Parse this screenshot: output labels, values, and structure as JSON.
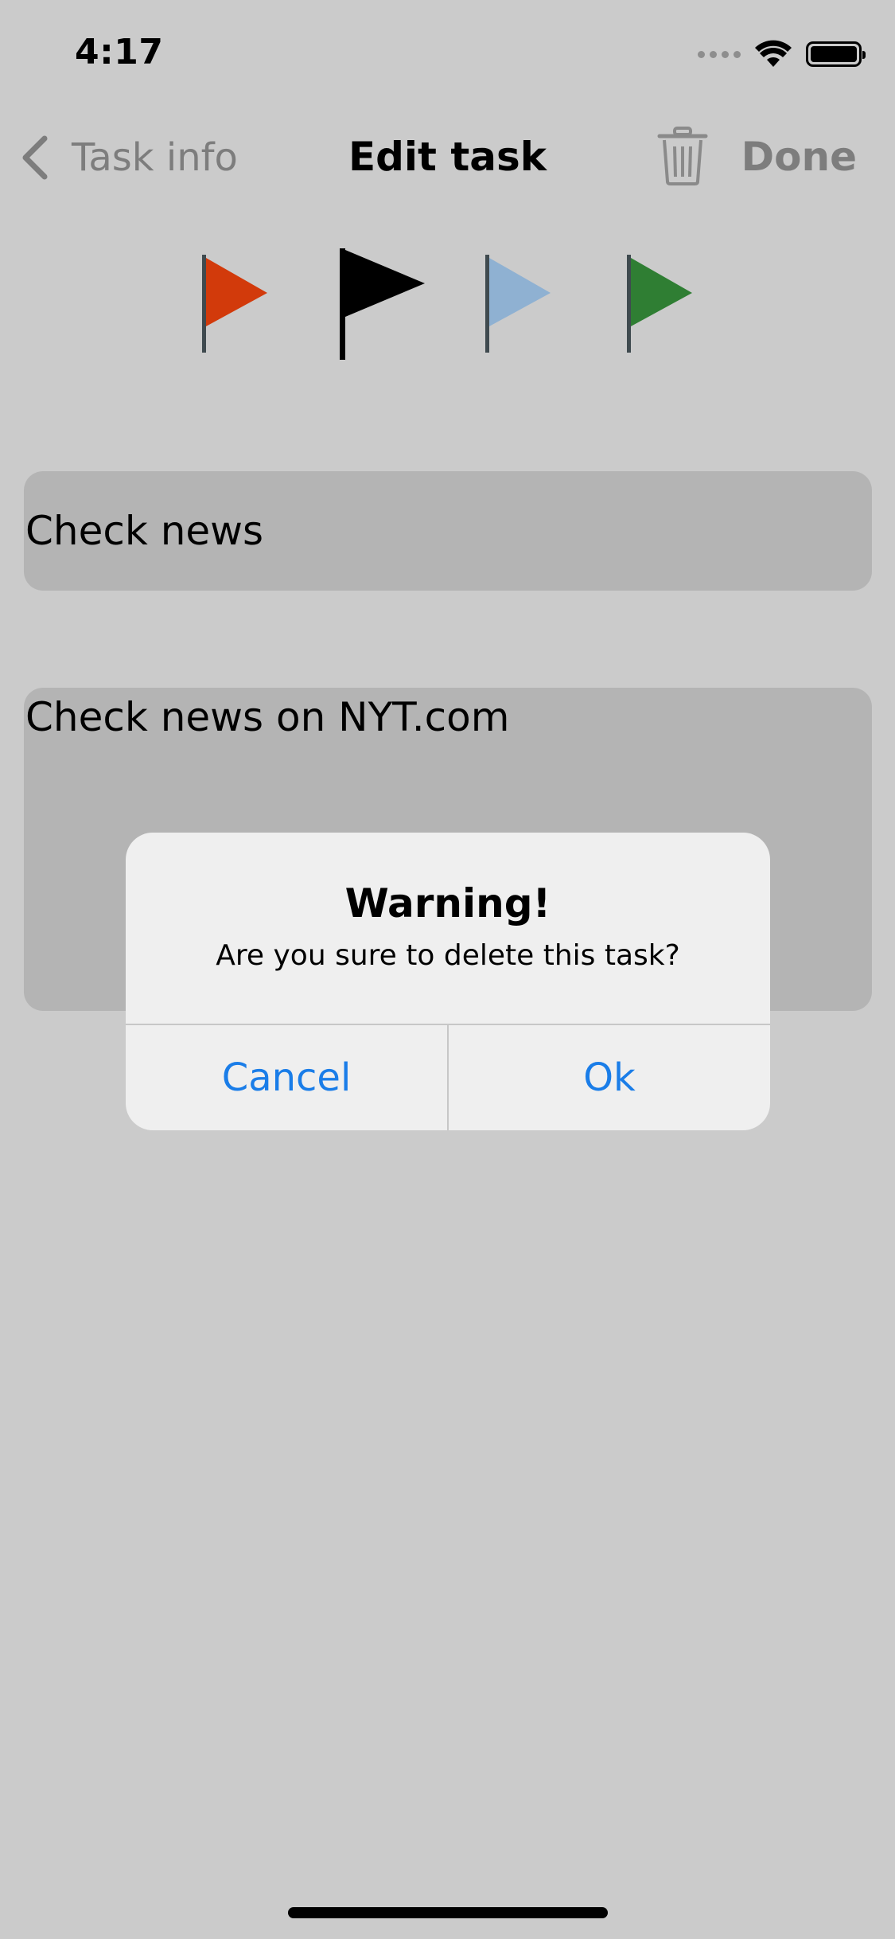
{
  "status_bar": {
    "time": "4:17"
  },
  "nav": {
    "back_label": "Task info",
    "title": "Edit task",
    "done_label": "Done"
  },
  "flags": [
    {
      "name": "red",
      "color": "#d23a0b"
    },
    {
      "name": "black",
      "color": "#000000"
    },
    {
      "name": "light-blue",
      "color": "#8fb1d2"
    },
    {
      "name": "green",
      "color": "#2f7e33"
    }
  ],
  "task": {
    "title": "Check news",
    "notes": "Check news on NYT.com"
  },
  "alert": {
    "title": "Warning!",
    "message": "Are you sure to delete this task?",
    "cancel_label": "Cancel",
    "ok_label": "Ok"
  },
  "colors": {
    "accent": "#1a7de8",
    "background": "#cbcbcb",
    "field": "#b4b4b4"
  }
}
